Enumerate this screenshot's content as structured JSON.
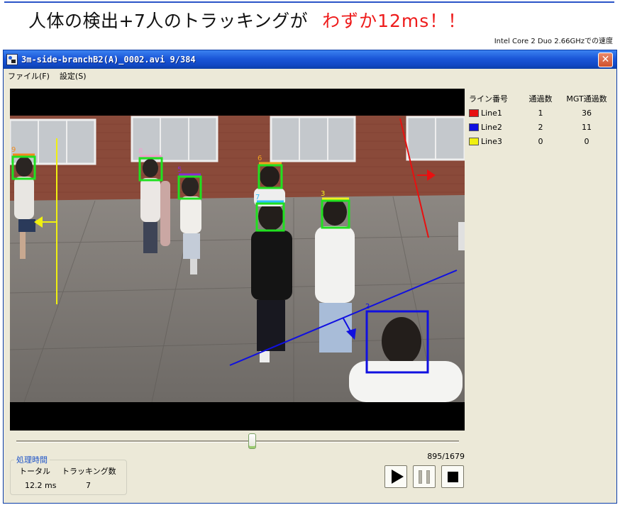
{
  "banner": {
    "headline": "人体の検出+7人のトラッキングが",
    "headline_accent": "わずか12ms！！",
    "cpu_note": "Intel Core 2 Duo 2.66GHzでの速度"
  },
  "window": {
    "title": "3m-side-branchB2(A)_0002.avi  9/384",
    "close_label": "✕"
  },
  "menu": {
    "items": [
      {
        "label": "ファイル(F)"
      },
      {
        "label": "設定(S)"
      }
    ]
  },
  "line_table": {
    "headers": [
      "ライン番号",
      "通過数",
      "MGT通過数"
    ],
    "rows": [
      {
        "name": "Line1",
        "color": "#e81010",
        "count": "1",
        "mgt_count": "36"
      },
      {
        "name": "Line2",
        "color": "#1010e0",
        "count": "2",
        "mgt_count": "11"
      },
      {
        "name": "Line3",
        "color": "#f0f010",
        "count": "0",
        "mgt_count": "0"
      }
    ]
  },
  "playback": {
    "frame_counter": "895/1679",
    "position_fraction": 0.533
  },
  "processing": {
    "legend": "処理時間",
    "total_label": "トータル",
    "tracking_label": "トラッキング数",
    "total_value": "12.2 ms",
    "tracking_value": "7"
  },
  "video": {
    "track_ids": [
      {
        "id": "9",
        "color": "#f08a1e"
      },
      {
        "id": "8",
        "color": "#f0a0d0"
      },
      {
        "id": "5",
        "color": "#8a2ad0"
      },
      {
        "id": "6",
        "color": "#f0a020"
      },
      {
        "id": "7",
        "color": "#30c0ff"
      },
      {
        "id": "3",
        "color": "#f0f020"
      },
      {
        "id": "2",
        "color": "#1010e0"
      }
    ]
  }
}
